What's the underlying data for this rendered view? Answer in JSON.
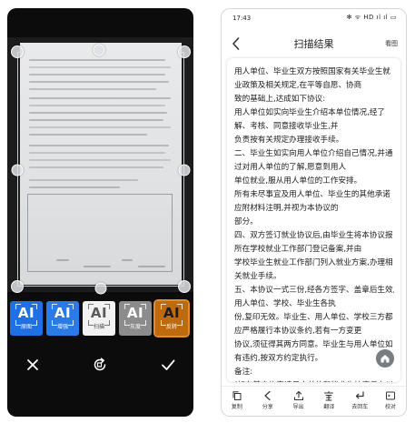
{
  "left": {
    "filters": [
      {
        "icon_text": "AI",
        "label": "原图"
      },
      {
        "icon_text": "AI",
        "label": "增强"
      },
      {
        "icon_text": "AI",
        "label": "扫描"
      },
      {
        "icon_text": "AI",
        "label": "灰度"
      },
      {
        "icon_text": "AI",
        "label": "反转"
      }
    ],
    "icons": {
      "cancel": "close-icon",
      "rotate": "rotate-icon",
      "confirm": "check-icon"
    },
    "colors": {
      "selected_filter": "#c06a10",
      "filter_blue": "#1f6fe5"
    }
  },
  "right": {
    "status_time": "17:43",
    "status_icons": "✻ ᯤ HD ıl ıl ▭",
    "title": "扫描结果",
    "view_original": "看图",
    "lines": [
      "用人单位、毕业生双方按照国家有关毕业生就",
      "业政策及相关规定,在平等自愿、协商",
      "致的基础上,达成如下协议:",
      "用人单位如实向毕业生介绍本单位情况,经了",
      "解、考核、同意接收毕业生,并",
      "负责按有关规定办理接收手续。",
      "二、毕业生如实向用人单位介绍自己情况,并通",
      "过对用人单位的了解,愿意到用人",
      "单位就业,服从用人单位的工作安排。",
      "所有未尽事宜及用人单位、毕业生的其他承诺",
      "应附材料注明,并视为本协议的",
      "部分。",
      "四、双方签订就业协议后,由毕业生将本协议报",
      "所在学校就业工作部门登记备案,并由",
      "学校毕业生就业工作部门列入就业方案,办理相",
      "关就业手续。",
      "五、本协议一式三份,经各方签字、盖章后生效,",
      "用人单位、学校、毕业生各执",
      "份,复印无效。毕业生、用人单位、学校三方都",
      "应严格履行本协议条约,若有一方变更",
      "协议,须征得其两方同意。毕业生与用人单位如",
      "有违约,按双方约定执行。",
      "备注:",
      "(如有其它约定请用人单位和毕业生协商后在以",
      "下空白处填写并签字和盖章。)"
    ],
    "toolbar": [
      {
        "icon": "copy-icon",
        "label": "复制"
      },
      {
        "icon": "share-icon",
        "label": "分享"
      },
      {
        "icon": "export-icon",
        "label": "导出"
      },
      {
        "icon": "translate-icon",
        "label": "翻译"
      },
      {
        "icon": "return-icon",
        "label": "去回车"
      },
      {
        "icon": "proofread-icon",
        "label": "校对"
      }
    ],
    "colors": {
      "text": "#1c1c1c",
      "fab": "#777c80"
    }
  }
}
